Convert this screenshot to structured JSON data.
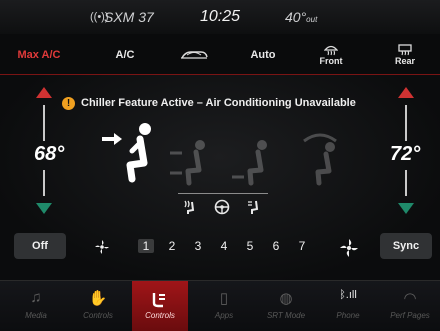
{
  "status_bar": {
    "radio_icon": "((•))",
    "station": "SXM 37",
    "time": "10:25",
    "outside_temp": "40°",
    "outside_label": "out"
  },
  "top_buttons": [
    {
      "label": "Max A/C",
      "color": "#e03a3a"
    },
    {
      "label": "A/C"
    },
    {
      "icon": "recirculation-icon"
    },
    {
      "label": "Auto"
    },
    {
      "label": "Front",
      "icon": "front-defrost-icon"
    },
    {
      "label": "Rear",
      "icon": "rear-defrost-icon"
    }
  ],
  "banner": {
    "icon": "!",
    "text": "Chiller Feature Active – Air Conditioning Unavailable"
  },
  "driver_temp": {
    "value": "68°"
  },
  "passenger_temp": {
    "value": "72°"
  },
  "fan": {
    "off_label": "Off",
    "sync_label": "Sync",
    "speeds": [
      "1",
      "2",
      "3",
      "4",
      "5",
      "6",
      "7"
    ],
    "current_speed": 1
  },
  "dock": [
    {
      "label": "Media",
      "icon": "music-note-icon"
    },
    {
      "label": "Controls",
      "icon": "controls-icon"
    },
    {
      "label": "Controls",
      "icon": "climate-icon",
      "active": true
    },
    {
      "label": "Apps",
      "icon": "apps-icon"
    },
    {
      "label": "SRT Mode",
      "icon": "srt-mode-icon"
    },
    {
      "label": "Phone",
      "icon": "phone-icon"
    },
    {
      "label": "Perf Pages",
      "icon": "performance-pages-icon"
    }
  ],
  "colors": {
    "accent_red": "#c21a1d",
    "active_red": "#a01518",
    "warning_orange": "#f0a020",
    "down_arrow": "#1f8a6a"
  }
}
